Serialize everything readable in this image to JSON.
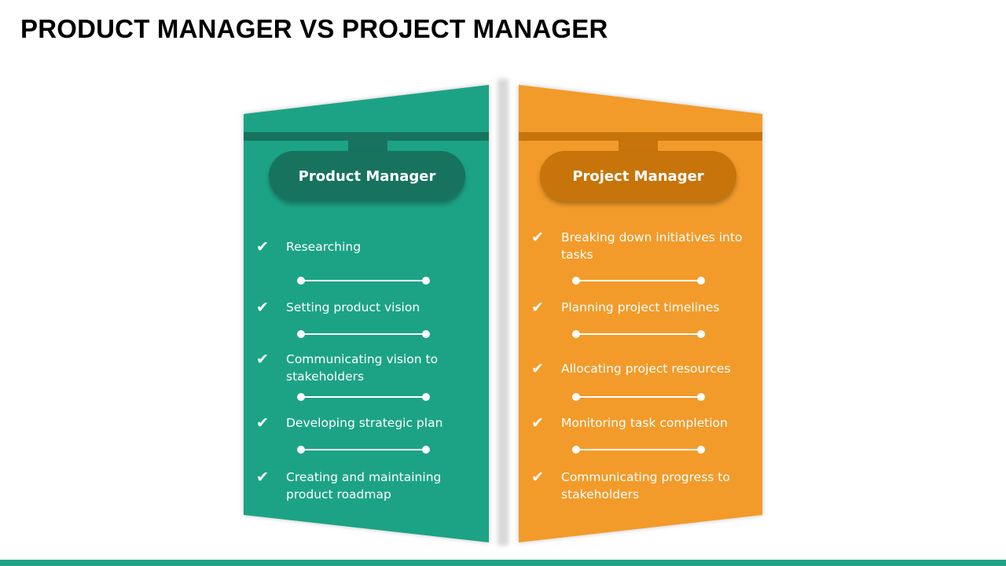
{
  "title": "PRODUCT MANAGER VS PROJECT MANAGER",
  "colors": {
    "green": "#1fa386",
    "green_dark": "#17735e",
    "orange": "#f29b2a",
    "orange_dark": "#c7740a"
  },
  "left_panel": {
    "heading": "Product Manager",
    "check_icon": "✔",
    "items": [
      "Researching",
      "Setting product vision",
      "Communicating vision to stakeholders",
      "Developing strategic plan",
      "Creating and maintaining product roadmap"
    ]
  },
  "right_panel": {
    "heading": "Project Manager",
    "check_icon": "✔",
    "items": [
      "Breaking down initiatives into tasks",
      "Planning project timelines",
      "Allocating project resources",
      "Monitoring task completion",
      "Communicating progress to stakeholders"
    ]
  }
}
